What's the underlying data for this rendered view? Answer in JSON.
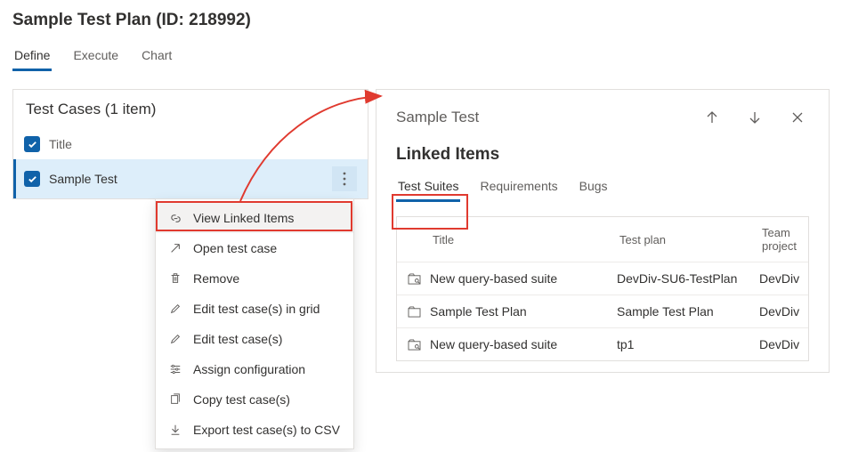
{
  "header": {
    "title": "Sample Test Plan (ID: 218992)"
  },
  "tabs": [
    {
      "label": "Define",
      "active": true
    },
    {
      "label": "Execute",
      "active": false
    },
    {
      "label": "Chart",
      "active": false
    }
  ],
  "testCases": {
    "heading": "Test Cases (1 item)",
    "columnHeader": "Title",
    "rows": [
      {
        "title": "Sample Test",
        "selected": true
      }
    ]
  },
  "contextMenu": {
    "items": [
      {
        "label": "View Linked Items",
        "icon": "link-icon",
        "highlighted": true
      },
      {
        "label": "Open test case",
        "icon": "open-icon"
      },
      {
        "label": "Remove",
        "icon": "trash-icon"
      },
      {
        "label": "Edit test case(s) in grid",
        "icon": "pencil-icon"
      },
      {
        "label": "Edit test case(s)",
        "icon": "pencil-icon"
      },
      {
        "label": "Assign configuration",
        "icon": "config-icon"
      },
      {
        "label": "Copy test case(s)",
        "icon": "copy-icon"
      },
      {
        "label": "Export test case(s) to CSV",
        "icon": "download-icon"
      }
    ]
  },
  "linkedPanel": {
    "title": "Sample Test",
    "sectionTitle": "Linked Items",
    "subTabs": [
      {
        "label": "Test Suites",
        "active": true
      },
      {
        "label": "Requirements",
        "active": false
      },
      {
        "label": "Bugs",
        "active": false
      }
    ],
    "table": {
      "headers": {
        "title": "Title",
        "plan": "Test plan",
        "team": "Team project"
      },
      "rows": [
        {
          "icon": "suite-query-icon",
          "title": "New query-based suite",
          "plan": "DevDiv-SU6-TestPlan",
          "team": "DevDiv"
        },
        {
          "icon": "suite-static-icon",
          "title": "Sample Test Plan",
          "plan": "Sample Test Plan",
          "team": "DevDiv"
        },
        {
          "icon": "suite-query-icon",
          "title": "New query-based suite",
          "plan": "tp1",
          "team": "DevDiv"
        }
      ]
    }
  }
}
